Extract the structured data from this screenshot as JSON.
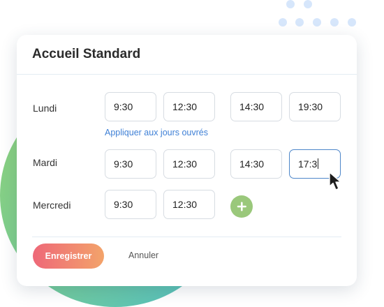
{
  "card": {
    "title": "Accueil Standard"
  },
  "schedule": [
    {
      "day": "Lundi",
      "slots": [
        "9:30",
        "12:30",
        "14:30",
        "19:30"
      ]
    },
    {
      "day": "Mardi",
      "slots": [
        "9:30",
        "12:30",
        "14:30",
        "17:3"
      ]
    },
    {
      "day": "Mercredi",
      "slots": [
        "9:30",
        "12:30"
      ]
    }
  ],
  "apply_link": "Appliquer aux jours ouvrés",
  "actions": {
    "save_label": "Enregistrer",
    "cancel_label": "Annuler"
  },
  "icons": {
    "add": "plus-icon",
    "cursor": "mouse-pointer-icon"
  },
  "colors": {
    "accent_blue": "#3f80d6",
    "add_green": "#9ac87b",
    "save_gradient_start": "#ee6878",
    "save_gradient_end": "#f3a36a",
    "focus_border": "#4d86c9"
  }
}
